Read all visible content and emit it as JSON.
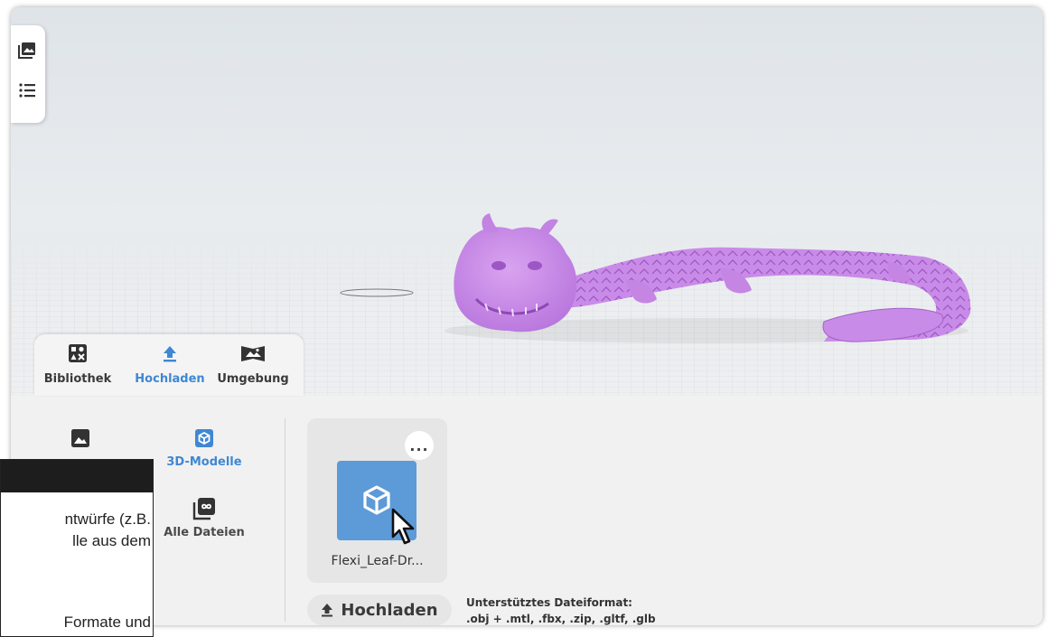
{
  "toolbar": {
    "icons": [
      "gallery-icon",
      "list-icon"
    ]
  },
  "tabs": [
    {
      "label": "Bibliothek",
      "icon": "library-icon",
      "active": false
    },
    {
      "label": "Hochladen",
      "icon": "upload-arrow-icon",
      "active": true
    },
    {
      "label": "Umgebung",
      "icon": "environment-icon",
      "active": false
    }
  ],
  "categories": [
    {
      "label": "",
      "icon": "image-icon",
      "active": false
    },
    {
      "label": "3D-Modelle",
      "icon": "cube-icon",
      "active": true
    },
    {
      "label": "Alle Dateien",
      "icon": "all-files-icon",
      "active": false
    }
  ],
  "file": {
    "name": "Flexi_Leaf-Dr...",
    "more_label": "..."
  },
  "upload": {
    "button_label": "Hochladen",
    "formats_title": "Unterstütztes Dateiformat:",
    "formats_list": ".obj + .mtl, .fbx, .zip, .gltf, .glb"
  },
  "info": {
    "line1": "ntwürfe (z.B.",
    "line2": "lle aus dem",
    "line3": "Formate und"
  },
  "colors": {
    "accent": "#3f87d3",
    "model": "#c98be8",
    "thumb": "#5d9ad8"
  }
}
